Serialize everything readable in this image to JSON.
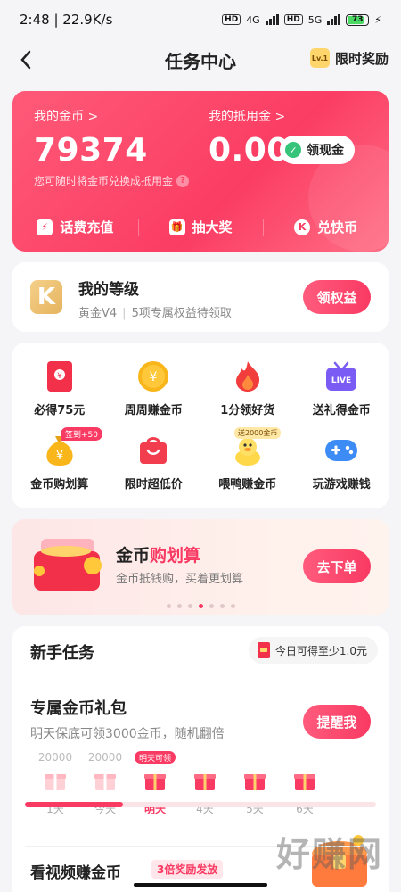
{
  "status": {
    "time": "2:48",
    "speed": "22.9K/s",
    "network1": "4G",
    "network2": "5G",
    "battery": "73"
  },
  "nav": {
    "title": "任务中心",
    "level_badge": "Lv.1",
    "reward_label": "限时奖励"
  },
  "coins": {
    "coin_label": "我的金币 >",
    "coin_value": "79374",
    "deduct_label": "我的抵用金 >",
    "deduct_value": "0.00",
    "cash_btn": "领现金",
    "hint": "您可随时将金币兑换成抵用金",
    "actions": [
      {
        "label": "话费充值",
        "icon": "lightning-icon"
      },
      {
        "label": "抽大奖",
        "icon": "gift-icon"
      },
      {
        "label": "兑快币",
        "icon": "k-coin-icon"
      }
    ]
  },
  "level": {
    "title": "我的等级",
    "grade": "黄金V4",
    "benefits": "5项专属权益待领取",
    "btn": "领权益"
  },
  "grid": [
    {
      "label": "必得75元",
      "icon": "red-envelope-icon"
    },
    {
      "label": "周周赚金币",
      "icon": "coin-icon"
    },
    {
      "label": "1分领好货",
      "icon": "flame-icon"
    },
    {
      "label": "送礼得金币",
      "icon": "live-icon"
    },
    {
      "label": "金币购划算",
      "icon": "money-bag-icon",
      "badge": "签到+50"
    },
    {
      "label": "限时超低价",
      "icon": "shopping-bag-icon"
    },
    {
      "label": "喂鸭赚金币",
      "icon": "duck-icon",
      "badge": "送2000金币"
    },
    {
      "label": "玩游戏赚钱",
      "icon": "gamepad-icon"
    }
  ],
  "banner": {
    "title_a": "金币",
    "title_b": "购划算",
    "subtitle": "金币抵钱购，买着更划算",
    "btn": "去下单",
    "pages": 7,
    "active_page": 3
  },
  "tasks": {
    "heading": "新手任务",
    "today_tip": "今日可得至少1.0元",
    "gift_title": "专属金币礼包",
    "gift_sub": "明天保底可领3000金币，随机翻倍",
    "remind_btn": "提醒我",
    "days": [
      {
        "amount": "20000",
        "label": "1天"
      },
      {
        "amount": "20000",
        "label": "今天"
      },
      {
        "amount": "",
        "tag": "明天可领",
        "label": "明天"
      },
      {
        "amount": "",
        "label": "4天"
      },
      {
        "amount": "",
        "label": "5天"
      },
      {
        "amount": "",
        "label": "6天"
      }
    ],
    "progress": 0.28,
    "video_title": "看视频赚金币",
    "video_badge": "3倍奖励发放"
  },
  "watermark": "好赚网"
}
